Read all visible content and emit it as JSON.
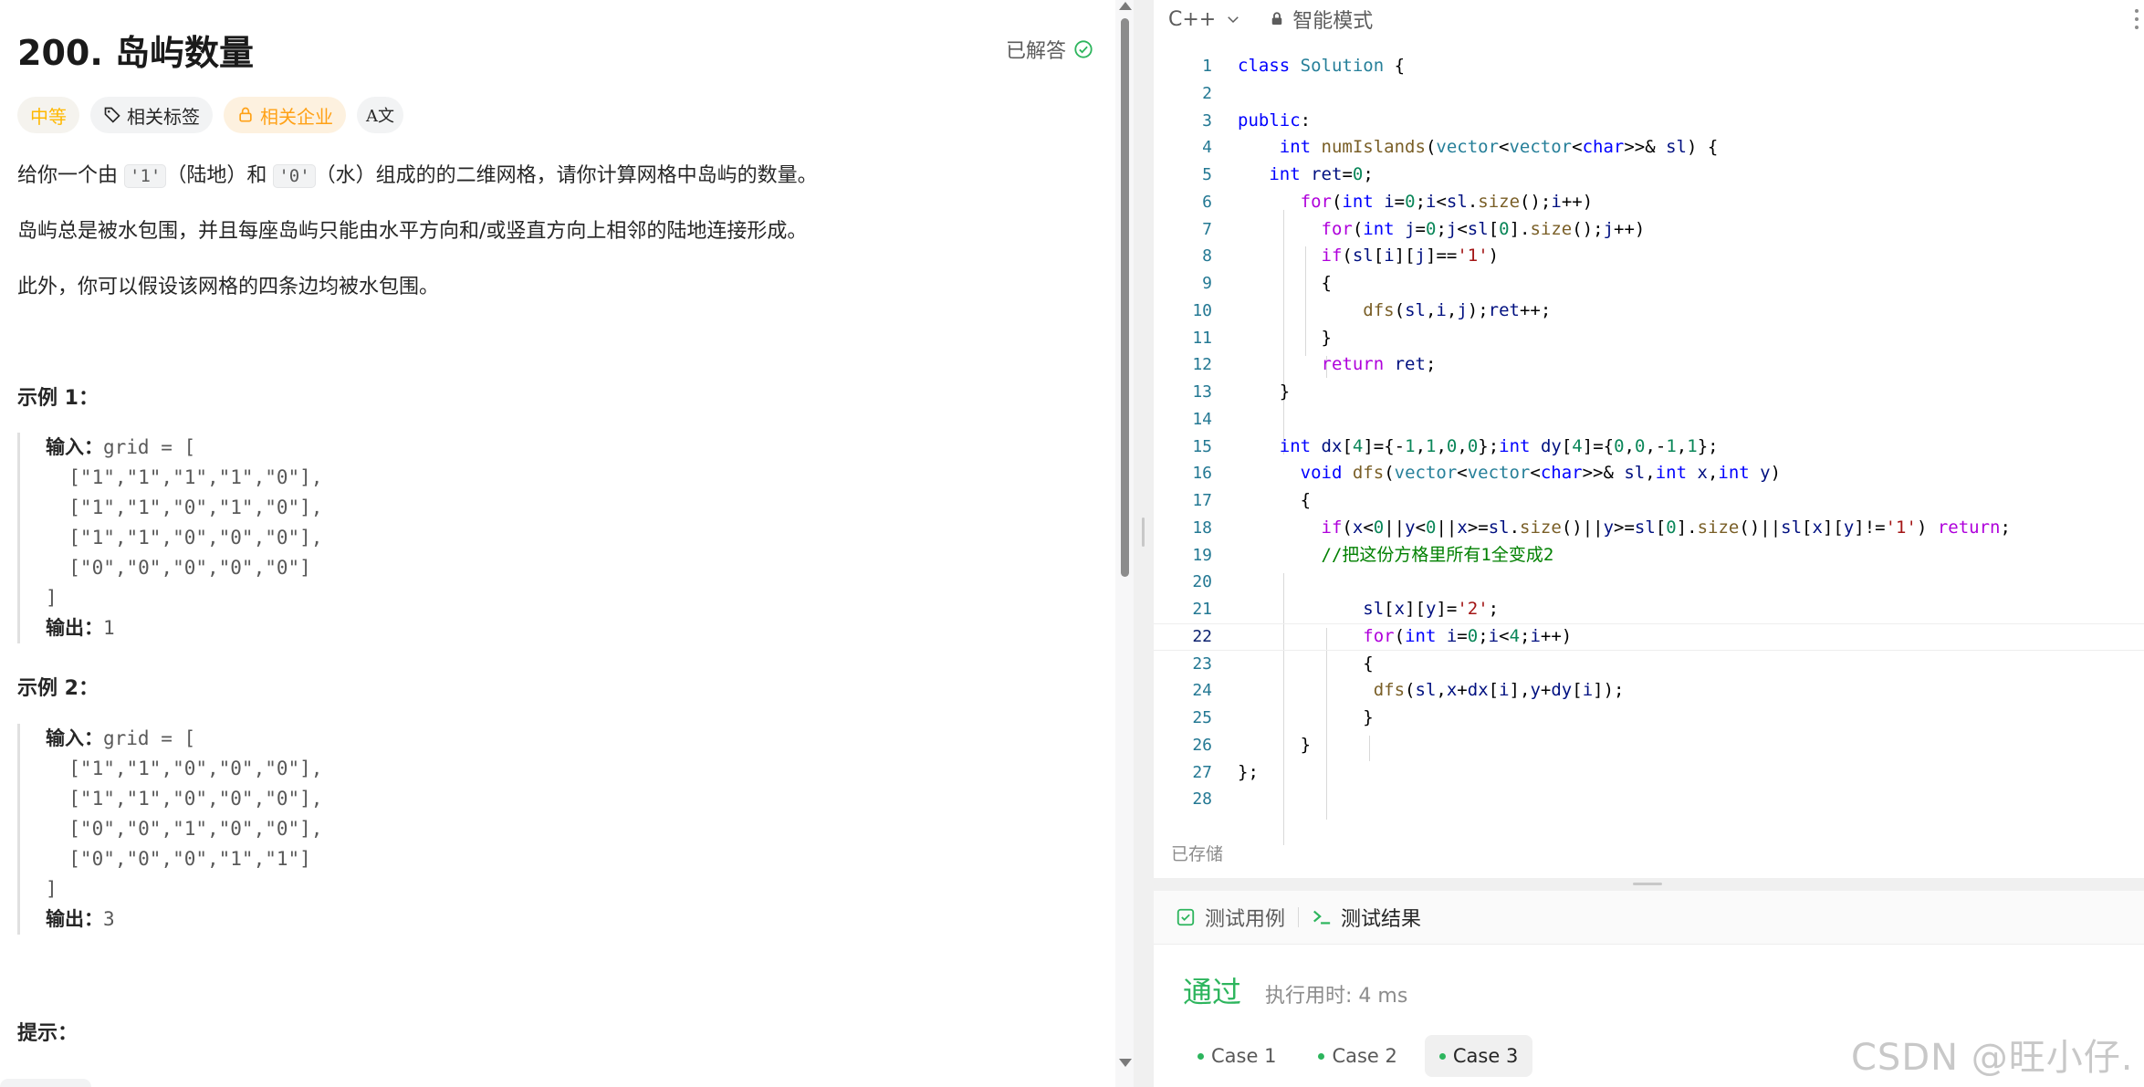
{
  "problem": {
    "title": "200. 岛屿数量",
    "status": "已解答",
    "tags": {
      "difficulty": "中等",
      "related_tags": "相关标签",
      "related_companies": "相关企业",
      "translate_icon_text": "A文"
    },
    "desc1": {
      "a": "给你一个由 ",
      "code1": "'1'",
      "b": "（陆地）和 ",
      "code2": "'0'",
      "c": "（水）组成的的二维网格，请你计算网格中岛屿的数量。"
    },
    "desc2": "岛屿总是被水包围，并且每座岛屿只能由水平方向和/或竖直方向上相邻的陆地连接形成。",
    "desc3": "此外，你可以假设该网格的四条边均被水包围。",
    "examples": [
      {
        "heading": "示例 1：",
        "input_label": "输入：",
        "input_head": "grid = [",
        "rows": [
          "  [\"1\",\"1\",\"1\",\"1\",\"0\"],",
          "  [\"1\",\"1\",\"0\",\"1\",\"0\"],",
          "  [\"1\",\"1\",\"0\",\"0\",\"0\"],",
          "  [\"0\",\"0\",\"0\",\"0\",\"0\"]"
        ],
        "close": "]",
        "output_label": "输出：",
        "output": "1"
      },
      {
        "heading": "示例 2：",
        "input_label": "输入：",
        "input_head": "grid = [",
        "rows": [
          "  [\"1\",\"1\",\"0\",\"0\",\"0\"],",
          "  [\"1\",\"1\",\"0\",\"0\",\"0\"],",
          "  [\"0\",\"0\",\"1\",\"0\",\"0\"],",
          "  [\"0\",\"0\",\"0\",\"1\",\"1\"]"
        ],
        "close": "]",
        "output_label": "输出：",
        "output": "3"
      }
    ],
    "hint_heading": "提示："
  },
  "editor": {
    "language": "C++",
    "mode": "智能模式",
    "current_line": 22,
    "line_count": 28,
    "saved_label": "已存储"
  },
  "console": {
    "tab_testcase": "测试用例",
    "tab_result": "测试结果",
    "status": "通过",
    "runtime": "执行用时: 4 ms",
    "cases": [
      "Case 1",
      "Case 2",
      "Case 3"
    ],
    "active_case": "Case 3"
  },
  "watermark": "CSDN @旺小仔.",
  "colors": {
    "accent_green": "#2db55d",
    "difficulty": "#ffb800",
    "company": "#ffa116"
  }
}
